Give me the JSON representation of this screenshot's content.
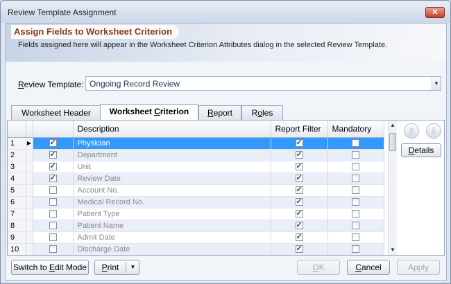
{
  "window": {
    "title": "Review Template Assignment",
    "close_glyph": "✕"
  },
  "banner": {
    "heading": "Assign Fields to Worksheet Criterion",
    "description": "Fields assigned here will appear in the Worksheet Criterion Attributes dialog in the selected Review Template."
  },
  "review_template": {
    "label_first": "R",
    "label_rest": "eview Template:",
    "value": "Ongoing Record Review",
    "arrow_glyph": "▼"
  },
  "tabs": [
    {
      "label": "Worksheet Header",
      "active": false
    },
    {
      "label_pre": "Worksheet ",
      "label_u": "C",
      "label_post": "riterion",
      "active": true
    },
    {
      "label_u": "R",
      "label_post": "eport",
      "active": false
    },
    {
      "label_pre": "R",
      "label_u": "o",
      "label_post": "les",
      "active": false
    }
  ],
  "grid": {
    "columns": [
      "",
      "",
      "",
      "Description",
      "Report Filter",
      "Mandatory"
    ],
    "current_row_glyph": "▶",
    "rows": [
      {
        "num": "1",
        "assigned": true,
        "description": "Physician",
        "report_filter": true,
        "mandatory": false,
        "selected": true
      },
      {
        "num": "2",
        "assigned": true,
        "description": "Department",
        "report_filter": true,
        "mandatory": false
      },
      {
        "num": "3",
        "assigned": true,
        "description": "Unit",
        "report_filter": true,
        "mandatory": false
      },
      {
        "num": "4",
        "assigned": true,
        "description": "Review Date",
        "report_filter": true,
        "mandatory": false
      },
      {
        "num": "5",
        "assigned": false,
        "description": "Account No.",
        "report_filter": true,
        "mandatory": false
      },
      {
        "num": "6",
        "assigned": false,
        "description": "Medical Record No.",
        "report_filter": true,
        "mandatory": false
      },
      {
        "num": "7",
        "assigned": false,
        "description": "Patient Type",
        "report_filter": true,
        "mandatory": false
      },
      {
        "num": "8",
        "assigned": false,
        "description": "Patient Name",
        "report_filter": true,
        "mandatory": false
      },
      {
        "num": "9",
        "assigned": false,
        "description": "Admit Date",
        "report_filter": true,
        "mandatory": false
      },
      {
        "num": "10",
        "assigned": false,
        "description": "Discharge Date",
        "report_filter": true,
        "mandatory": false
      }
    ]
  },
  "scrollbar": {
    "up_glyph": "▲",
    "down_glyph": "▼"
  },
  "side": {
    "move_up_glyph": "⇧",
    "move_down_glyph": "⇩",
    "details_label": "Details",
    "details_u": "D",
    "details_rest": "etails"
  },
  "buttons": {
    "edit_mode_pre": "Switch to ",
    "edit_mode_u": "E",
    "edit_mode_post": "dit Mode",
    "print_u": "P",
    "print_post": "rint",
    "print_dd_glyph": "▼",
    "ok_u": "O",
    "ok_post": "K",
    "cancel_u": "C",
    "cancel_post": "ancel",
    "apply_label": "Apply"
  }
}
